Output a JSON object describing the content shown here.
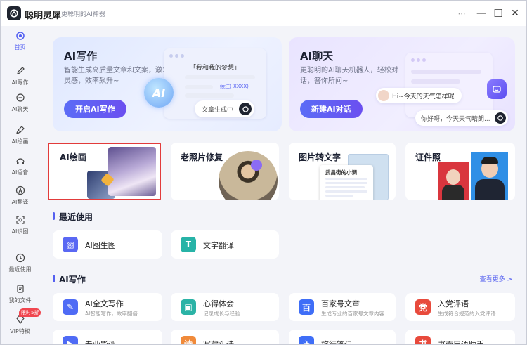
{
  "app": {
    "name": "聪明灵犀",
    "slogan": "更聪明的AI神器"
  },
  "window_controls": {
    "pin": "⋯",
    "minimize": "—",
    "maximize": "☐",
    "close": "✕"
  },
  "sidebar": {
    "items": [
      {
        "label": "首页",
        "icon": "home-icon",
        "active": true
      },
      {
        "label": "AI写作",
        "icon": "pen-icon"
      },
      {
        "label": "AI聊天",
        "icon": "chat-icon"
      },
      {
        "label": "AI绘画",
        "icon": "brush-icon"
      },
      {
        "label": "AI语音",
        "icon": "voice-icon"
      },
      {
        "label": "AI翻译",
        "icon": "translate-icon"
      },
      {
        "label": "AI识图",
        "icon": "scan-icon"
      },
      {
        "label": "最近使用",
        "icon": "clock-icon"
      },
      {
        "label": "我的文件",
        "icon": "file-icon"
      },
      {
        "label": "VIP特权",
        "icon": "diamond-icon"
      }
    ],
    "vip_badge": "限时5折"
  },
  "hero": {
    "write": {
      "title": "AI写作",
      "desc": "智能生成高质量文章和文案，激发灵感，效率飙升~",
      "button": "开启AI写作",
      "mock_title": "「我和我的梦想」",
      "mock_tag": "续注( XXXX)",
      "ai_badge": "AI",
      "status": "文章生成中"
    },
    "chat": {
      "title": "AI聊天",
      "desc": "更聪明的AI聊天机器人，轻松对话，答你所问~",
      "button": "新建AI对话",
      "q": "Hi~今天的天气怎样呢",
      "a": "你好呀，今天天气晴朗..."
    }
  },
  "features": [
    {
      "title": "AI绘画"
    },
    {
      "title": "老照片修复"
    },
    {
      "title": "图片转文字",
      "doc_title": "武昌街的小调"
    },
    {
      "title": "证件照"
    }
  ],
  "recent": {
    "title": "最近使用",
    "items": [
      {
        "name": "AI图生图",
        "icon": "image-gen-icon"
      },
      {
        "name": "文字翻译",
        "icon": "text-translate-icon"
      }
    ]
  },
  "writing": {
    "title": "AI写作",
    "see_more": "查看更多 >",
    "items": [
      {
        "name": "AI全文写作",
        "sub": "AI智能写作，效率翻倍",
        "icon": "pen-doc-icon",
        "color": "#4f6bf5"
      },
      {
        "name": "心得体会",
        "sub": "记录成长与经验",
        "icon": "notebook-icon",
        "color": "#2bb3a6"
      },
      {
        "name": "百家号文章",
        "sub": "生成专业的百家号文章内容",
        "icon": "baijia-icon",
        "color": "#3f6ef7"
      },
      {
        "name": "入党评语",
        "sub": "生成符合规范的入党评语",
        "icon": "party-icon",
        "color": "#e84a3c"
      },
      {
        "name": "专业影评",
        "sub": "",
        "icon": "film-icon",
        "color": "#4f6bf5"
      },
      {
        "name": "写藏头诗",
        "sub": "",
        "icon": "poem-icon",
        "color": "#f08a3a"
      },
      {
        "name": "旅行笔记",
        "sub": "",
        "icon": "travel-icon",
        "color": "#3f6ef7"
      },
      {
        "name": "书面用语助手",
        "sub": "",
        "icon": "assist-icon",
        "color": "#e84a3c"
      }
    ]
  },
  "colors": {
    "accent": "#5560f0",
    "selection": "#e23b3b"
  }
}
